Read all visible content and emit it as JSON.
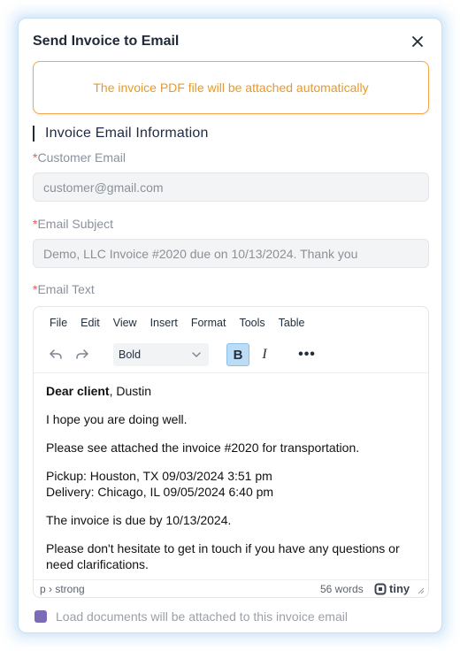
{
  "dialog": {
    "title": "Send Invoice to Email",
    "notice": "The invoice PDF file will be attached automatically",
    "section_title": "Invoice Email Information"
  },
  "fields": {
    "customer_email": {
      "label": "Customer Email",
      "value": "customer@gmail.com",
      "required": "*"
    },
    "email_subject": {
      "label": "Email Subject",
      "value": "Demo, LLC Invoice #2020 due on 10/13/2024. Thank you",
      "required": "*"
    },
    "email_text": {
      "label": "Email Text",
      "required": "*"
    }
  },
  "editor": {
    "menu": [
      "File",
      "Edit",
      "View",
      "Insert",
      "Format",
      "Tools",
      "Table"
    ],
    "block_format": "Bold",
    "bold_label": "B",
    "italic_label": "I",
    "more_label": "•••",
    "content": {
      "greeting_bold": "Dear client",
      "greeting_rest": ", Dustin",
      "line1": "I hope you are doing well.",
      "line2": "Please see attached the invoice #2020 for transportation.",
      "pickup": "Pickup: Houston, TX 09/03/2024 3:51 pm",
      "delivery": "Delivery: Chicago, IL 09/05/2024 6:40 pm",
      "due": "The invoice is due by 10/13/2024.",
      "closing": "Please don't hesitate to get in touch if you have any questions or need clarifications."
    },
    "status_path": "p › strong",
    "word_count": "56 words",
    "brand": "tiny"
  },
  "checkbox": {
    "label": "Load documents will be attached to this invoice email",
    "checked": true
  },
  "colors": {
    "notice_border": "#f3a64a",
    "notice_text": "#e59a2e",
    "required": "#e35b5b",
    "checkbox": "#7b6bb8",
    "bold_active": "#bcdcf6"
  }
}
